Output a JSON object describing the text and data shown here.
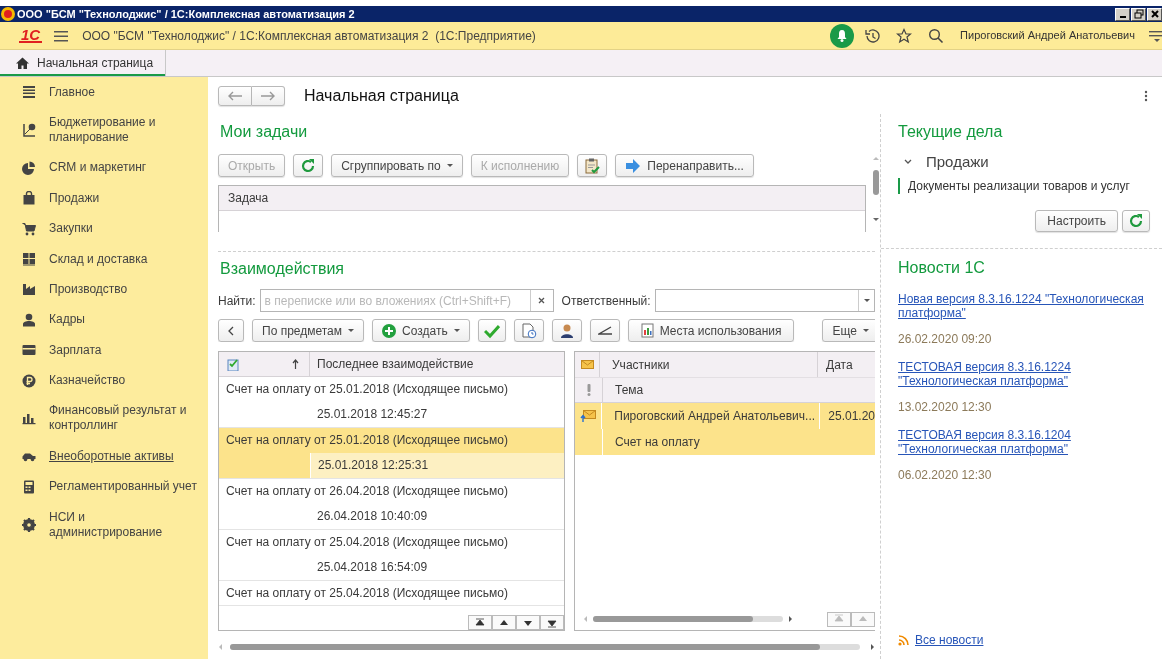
{
  "window": {
    "title": "ООО \"БСМ \"Технолоджис\" / 1С:Комплексная автоматизация 2"
  },
  "header": {
    "logo": "1С",
    "title": "ООО \"БСМ \"Технолоджис\" / 1С:Комплексная автоматизация 2  (1С:Предприятие)",
    "user": "Пироговский Андрей Анатольевич"
  },
  "tabs": [
    {
      "label": "Начальная страница",
      "selected": true
    }
  ],
  "sidebar": {
    "items": [
      {
        "label": "Главное",
        "hovered": false
      },
      {
        "label": "Бюджетирование и планирование",
        "hovered": false
      },
      {
        "label": "CRM и маркетинг",
        "hovered": false
      },
      {
        "label": "Продажи",
        "hovered": false
      },
      {
        "label": "Закупки",
        "hovered": false
      },
      {
        "label": "Склад и доставка",
        "hovered": false
      },
      {
        "label": "Производство",
        "hovered": false
      },
      {
        "label": "Кадры",
        "hovered": false
      },
      {
        "label": "Зарплата",
        "hovered": false
      },
      {
        "label": "Казначейство",
        "hovered": false
      },
      {
        "label": "Финансовый результат и контроллинг",
        "hovered": false
      },
      {
        "label": "Внеоборотные активы",
        "hovered": true
      },
      {
        "label": "Регламентированный учет",
        "hovered": false
      },
      {
        "label": "НСИ и администрирование",
        "hovered": false
      }
    ]
  },
  "page": {
    "title": "Начальная страница"
  },
  "tasks": {
    "title": "Мои задачи",
    "toolbar": [
      {
        "kind": "button",
        "label": "Открыть",
        "disabled": true
      },
      {
        "kind": "refresh",
        "disabled": false
      },
      {
        "kind": "dropdown",
        "label": "Сгруппировать по",
        "disabled": false
      },
      {
        "kind": "button",
        "label": "К исполнению",
        "disabled": true
      },
      {
        "kind": "clipboard",
        "disabled": false
      },
      {
        "kind": "forward",
        "label": "Перенаправить...",
        "disabled": false
      }
    ],
    "columns": [
      "Задача"
    ]
  },
  "interactions": {
    "title": "Взаимодействия",
    "search": {
      "label": "Найти:",
      "placeholder": "в переписке или во вложениях (Ctrl+Shift+F)"
    },
    "responsible": {
      "label": "Ответственный:"
    },
    "toolbar": [
      {
        "kind": "back"
      },
      {
        "kind": "dropdown",
        "label": "По предметам"
      },
      {
        "kind": "create",
        "label": "Создать"
      },
      {
        "kind": "check"
      },
      {
        "kind": "document"
      },
      {
        "kind": "person"
      },
      {
        "kind": "angle"
      },
      {
        "kind": "report",
        "label": "Места использования"
      },
      {
        "kind": "dropdown",
        "label": "Еще"
      }
    ],
    "list": {
      "column": "Последнее взаимодействие",
      "rows": [
        {
          "subject": "Счет на оплату от 25.01.2018 (Исходящее письмо)",
          "date": "25.01.2018 12:45:27",
          "selected": false
        },
        {
          "subject": "Счет на оплату от 25.01.2018 (Исходящее письмо)",
          "date": "25.01.2018 12:25:31",
          "selected": true
        },
        {
          "subject": "Счет на оплату от 26.04.2018 (Исходящее письмо)",
          "date": "26.04.2018 10:40:09",
          "selected": false
        },
        {
          "subject": "Счет на оплату от 25.04.2018 (Исходящее письмо)",
          "date": "25.04.2018 16:54:09",
          "selected": false
        },
        {
          "subject": "Счет на оплату от 25.04.2018 (Исходящее письмо)",
          "selected": false
        }
      ]
    },
    "details": {
      "columns": [
        "Участники",
        "Дата",
        "Тема"
      ],
      "rows": [
        {
          "participants": "Пироговский Андрей Анатольевич...",
          "date": "25.01.20",
          "subject": "Счет на оплату",
          "selected": true
        }
      ]
    }
  },
  "current": {
    "title": "Текущие дела",
    "groups": [
      {
        "label": "Продажи",
        "expanded": true,
        "items": [
          "Документы реализации товаров и услуг"
        ]
      }
    ],
    "settings_button": "Настроить"
  },
  "news": {
    "title": "Новости 1С",
    "items": [
      {
        "title": "Новая версия 8.3.16.1224 \"Технологическая платформа\"",
        "date": "26.02.2020 09:20"
      },
      {
        "title": "ТЕСТОВАЯ версия 8.3.16.1224 \"Технологическая платформа\"",
        "date": "13.02.2020 12:30"
      },
      {
        "title": "ТЕСТОВАЯ версия 8.3.16.1204 \"Технологическая платформа\"",
        "date": "06.02.2020 12:30"
      }
    ],
    "all_link": "Все новости"
  }
}
